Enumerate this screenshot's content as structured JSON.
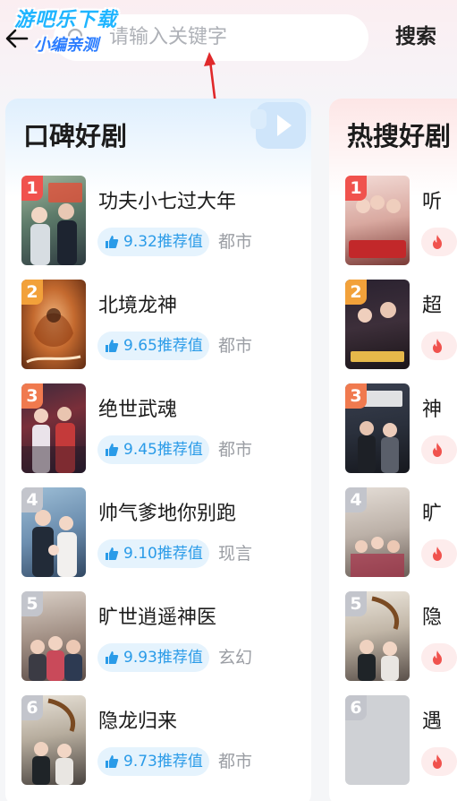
{
  "search": {
    "placeholder": "请输入关键字",
    "button_label": "搜索"
  },
  "watermark": {
    "line1": "游吧乐下载",
    "line2": "小编亲测"
  },
  "colors": {
    "rank_1": "#f0524d",
    "rank_2": "#f2a13a",
    "rank_3": "#f07a4f",
    "rank_other": "#c3c5cc",
    "badge_text": "#2a9be8",
    "arrow": "#e0282a"
  },
  "panels": {
    "koubei": {
      "title": "口碑好剧",
      "items": [
        {
          "rank": "1",
          "title": "功夫小七过大年",
          "score": "9.32推荐值",
          "genre": "都市"
        },
        {
          "rank": "2",
          "title": "北境龙神",
          "score": "9.65推荐值",
          "genre": "都市"
        },
        {
          "rank": "3",
          "title": "绝世武魂",
          "score": "9.45推荐值",
          "genre": "都市"
        },
        {
          "rank": "4",
          "title": "帅气爹地你别跑",
          "score": "9.10推荐值",
          "genre": "现言"
        },
        {
          "rank": "5",
          "title": "旷世逍遥神医",
          "score": "9.93推荐值",
          "genre": "玄幻"
        },
        {
          "rank": "6",
          "title": "隐龙归来",
          "score": "9.73推荐值",
          "genre": "都市"
        }
      ]
    },
    "resou": {
      "title": "热搜好剧",
      "items": [
        {
          "rank": "1",
          "title": "听"
        },
        {
          "rank": "2",
          "title": "超"
        },
        {
          "rank": "3",
          "title": "神"
        },
        {
          "rank": "4",
          "title": "旷"
        },
        {
          "rank": "5",
          "title": "隐"
        },
        {
          "rank": "6",
          "title": "遇"
        }
      ]
    }
  }
}
